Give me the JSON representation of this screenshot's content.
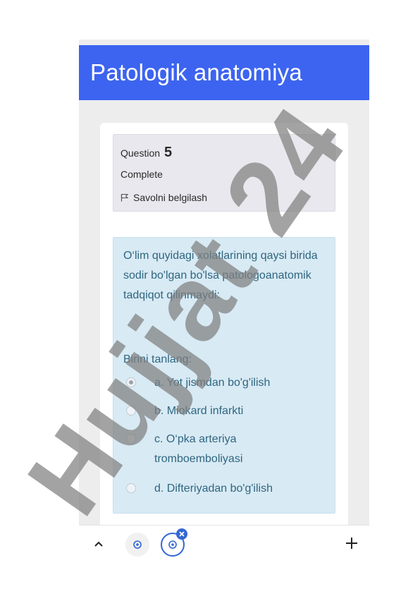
{
  "header": {
    "title": "Patologik anatomiya"
  },
  "question_info": {
    "label": "Question",
    "number": "5",
    "state": "Complete",
    "flag_label": "Savolni belgilash"
  },
  "question": {
    "text": "O‘lim quyidagi xolatlarining qaysi birida sodir bo'lgan bo'lsa patologoanatomik tadqiqot qilinmaydi:",
    "prompt": "Birini tanlang:",
    "answers": [
      {
        "label": "a. Yot jismdan bo'g'ilish",
        "selected": true
      },
      {
        "label": "b. Miokard infarkti",
        "selected": false
      },
      {
        "label": "c. O‘pka arteriya tromboemboliyasi",
        "selected": false
      },
      {
        "label": "d. Difteriyadan bo'g'ilish",
        "selected": false
      }
    ]
  },
  "watermark": {
    "text": "Hujjat 24"
  },
  "colors": {
    "header_bg": "#3c64f0",
    "question_bg": "#d8eaf4",
    "question_text": "#2f6680",
    "info_bg": "#e9e8ee"
  },
  "bottom_bar": {
    "icons": [
      "chevron-up-icon",
      "tab-icon",
      "active-tab-icon",
      "close-badge-icon",
      "plus-icon"
    ]
  }
}
